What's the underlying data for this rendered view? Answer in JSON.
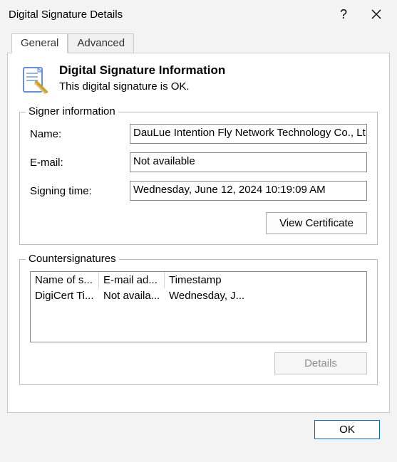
{
  "window_title": "Digital Signature Details",
  "tabs": {
    "general": "General",
    "advanced": "Advanced"
  },
  "heading": "Digital Signature Information",
  "subheading": "This digital signature is OK.",
  "signer_group_label": "Signer information",
  "fields": {
    "name_label": "Name:",
    "name_value": "DauLue Intention Fly Network Technology Co., Lt",
    "email_label": "E-mail:",
    "email_value": "Not available",
    "time_label": "Signing time:",
    "time_value": "Wednesday, June 12, 2024 10:19:09 AM"
  },
  "view_cert_label": "View Certificate",
  "counter_group_label": "Countersignatures",
  "counter_headers": {
    "name": "Name of s...",
    "email": "E-mail ad...",
    "timestamp": "Timestamp"
  },
  "counter_row": {
    "name": "DigiCert Ti...",
    "email": "Not availa...",
    "timestamp": "Wednesday, J..."
  },
  "details_label": "Details",
  "ok_label": "OK"
}
